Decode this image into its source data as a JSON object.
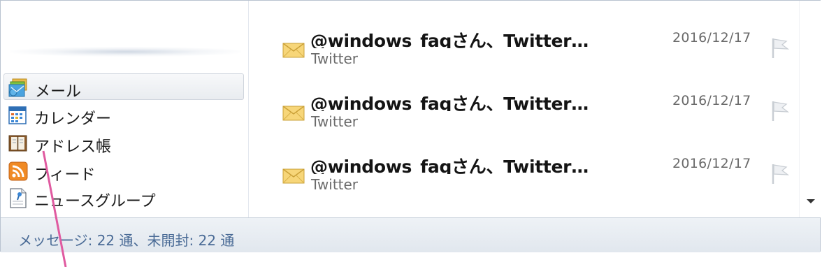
{
  "nav": {
    "items": [
      {
        "label": "メール",
        "icon": "mail-icon",
        "selected": true
      },
      {
        "label": "カレンダー",
        "icon": "calendar-icon",
        "selected": false
      },
      {
        "label": "アドレス帳",
        "icon": "address-book-icon",
        "selected": false
      },
      {
        "label": "フィード",
        "icon": "rss-feed-icon",
        "selected": false
      },
      {
        "label": "ニュースグループ",
        "icon": "newsgroup-icon",
        "selected": false
      }
    ]
  },
  "messages": [
    {
      "subject": "@windows_faqさん、Twitterでフォローされました",
      "sender": "Twitter",
      "date": "2016/12/17"
    },
    {
      "subject": "@windows_faqさん、Twitterでフォローされました",
      "sender": "Twitter",
      "date": "2016/12/17"
    },
    {
      "subject": "@windows_faqさん、Twitterでフォローされました",
      "sender": "Twitter",
      "date": "2016/12/17"
    }
  ],
  "status": {
    "text": "メッセージ: 22 通、未開封: 22 通"
  },
  "colors": {
    "status_text": "#4a6b96",
    "annotation_line": "#e05aa0",
    "envelope": "#f2c75c"
  }
}
